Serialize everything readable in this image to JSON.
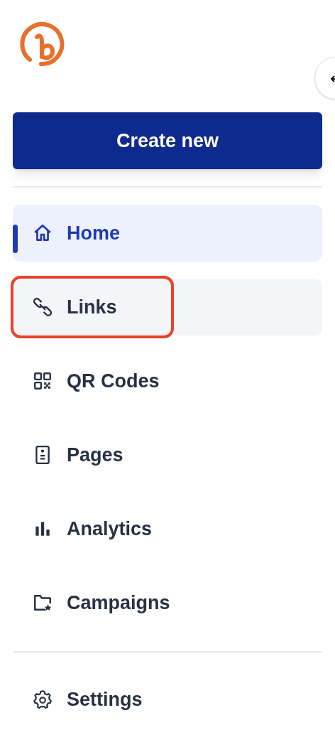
{
  "create_button": {
    "label": "Create new"
  },
  "nav_items": [
    {
      "label": "Home",
      "selected": true,
      "highlighted": false
    },
    {
      "label": "Links",
      "selected": false,
      "highlighted": true
    },
    {
      "label": "QR Codes",
      "selected": false,
      "highlighted": false
    },
    {
      "label": "Pages",
      "selected": false,
      "highlighted": false
    },
    {
      "label": "Analytics",
      "selected": false,
      "highlighted": false
    },
    {
      "label": "Campaigns",
      "selected": false,
      "highlighted": false
    }
  ],
  "footer_items": [
    {
      "label": "Settings",
      "selected": false,
      "highlighted": false
    }
  ]
}
